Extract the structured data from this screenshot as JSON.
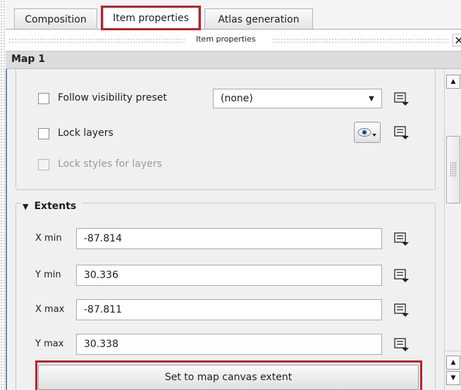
{
  "tabs": [
    {
      "label": "Composition",
      "active": false
    },
    {
      "label": "Item properties",
      "active": true
    },
    {
      "label": "Atlas generation",
      "active": false
    }
  ],
  "panel": {
    "title": "Item properties",
    "close_glyph": "✕"
  },
  "map_header": "Map 1",
  "layers": {
    "follow_visibility_preset": {
      "label": "Follow visibility preset",
      "checked": false,
      "combo_value": "(none)"
    },
    "lock_layers": {
      "label": "Lock layers",
      "checked": false
    },
    "lock_styles": {
      "label": "Lock styles for layers",
      "checked": false,
      "enabled": false
    }
  },
  "extents": {
    "title": "Extents",
    "fields": [
      {
        "label": "X min",
        "value": "-87.814"
      },
      {
        "label": "Y min",
        "value": "30.336"
      },
      {
        "label": "X max",
        "value": "-87.811"
      },
      {
        "label": "Y max",
        "value": "30.338"
      }
    ],
    "button_label": "Set to map canvas extent"
  },
  "colors": {
    "highlight": "#b8222c",
    "panel_bg": "#f0f0f0",
    "header_bg": "#dcdcdc"
  },
  "icons": {
    "data_defined": "data-defined-override-icon",
    "eye": "eye-icon",
    "combo_arrow": "chevron-down-icon",
    "expand": "triangle-down-icon",
    "scroll_up": "scroll-up-arrow-icon",
    "scroll_down": "scroll-down-arrow-icon"
  }
}
